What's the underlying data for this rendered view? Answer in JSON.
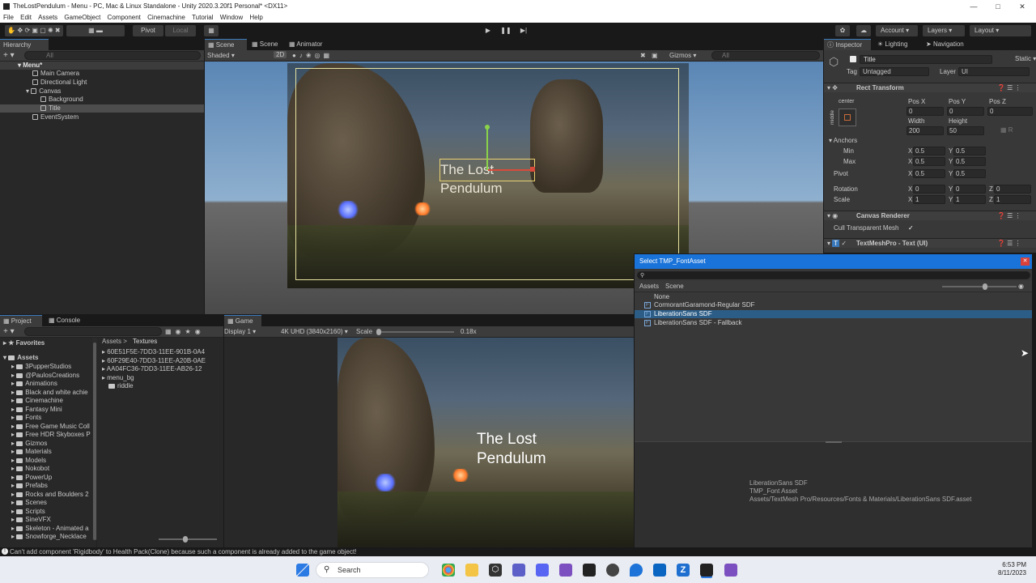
{
  "window": {
    "title": "TheLostPendulum - Menu - PC, Mac & Linux Standalone - Unity 2020.3.20f1 Personal* <DX11>"
  },
  "menubar": [
    "File",
    "Edit",
    "Assets",
    "GameObject",
    "Component",
    "Cinemachine",
    "Tutorial",
    "Window",
    "Help"
  ],
  "toolbar": {
    "pivot": "Pivot",
    "local": "Local",
    "account": "Account",
    "layers": "Layers",
    "layout": "Layout"
  },
  "hierarchy": {
    "tab": "Hierarchy",
    "search_placeholder": "All",
    "scene": "Menu*",
    "items": [
      "Main Camera",
      "Directional Light",
      "Canvas",
      "Background",
      "Title",
      "EventSystem"
    ]
  },
  "scene_view": {
    "tabs": [
      "Scene",
      "Scene",
      "Animator"
    ],
    "shading": "Shaded",
    "mode_2d": "2D",
    "gizmos": "Gizmos",
    "search_placeholder": "All",
    "overlay_title": "The Lost Pendulum"
  },
  "inspector": {
    "tabs": [
      "Inspector",
      "Lighting",
      "Navigation"
    ],
    "object_name": "Title",
    "static_label": "Static",
    "tag_label": "Tag",
    "tag_value": "Untagged",
    "layer_label": "Layer",
    "layer_value": "UI",
    "rect_transform": {
      "header": "Rect Transform",
      "anchor_preset": "center",
      "anchor_side": "middle",
      "pos_x_label": "Pos X",
      "pos_x": "0",
      "pos_y_label": "Pos Y",
      "pos_y": "0",
      "pos_z_label": "Pos Z",
      "pos_z": "0",
      "width_label": "Width",
      "width": "200",
      "height_label": "Height",
      "height": "50",
      "anchors_label": "Anchors",
      "min_label": "Min",
      "min_x": "0.5",
      "min_y": "0.5",
      "max_label": "Max",
      "max_x": "0.5",
      "max_y": "0.5",
      "pivot_label": "Pivot",
      "pivot_x": "0.5",
      "pivot_y": "0.5",
      "rotation_label": "Rotation",
      "rot_x": "0",
      "rot_y": "0",
      "rot_z": "0",
      "scale_label": "Scale",
      "scale_x": "1",
      "scale_y": "1",
      "scale_z": "1",
      "x": "X",
      "y": "Y",
      "z": "Z"
    },
    "canvas_renderer": {
      "header": "Canvas Renderer",
      "cull_label": "Cull Transparent Mesh"
    },
    "textmeshpro": {
      "header": "TextMeshPro - Text (UI)"
    }
  },
  "project": {
    "tabs": [
      "Project",
      "Console"
    ],
    "favorites": "Favorites",
    "assets_root": "Assets",
    "folders": [
      "3PupperStudios",
      "@PaulosCreations",
      "Animations",
      "Black and white achie",
      "Cinemachine",
      "Fantasy Mini",
      "Fonts",
      "Free Game Music Coll",
      "Free HDR Skyboxes P",
      "Gizmos",
      "Materials",
      "Models",
      "Nokobot",
      "PowerUp",
      "Prefabs",
      "Rocks and Boulders 2",
      "Scenes",
      "Scripts",
      "SineVFX",
      "Skeleton - Animated a",
      "Snowforge_Necklace"
    ],
    "breadcrumb": [
      "Assets",
      "Textures"
    ],
    "files": [
      "60E51F5E-7DD3-11EE-901B-0A4",
      "60F29E40-7DD3-11EE-A20B-0AE",
      "AA04FC36-7DD3-11EE-AB26-12",
      "menu_bg",
      "riddle"
    ]
  },
  "game_view": {
    "tab": "Game",
    "display": "Display 1",
    "resolution": "4K UHD (3840x2160)",
    "scale_label": "Scale",
    "scale_value": "0.18x",
    "overlay_line1": "The Lost",
    "overlay_line2": "Pendulum"
  },
  "picker": {
    "title": "Select TMP_FontAsset",
    "tabs": [
      "Assets",
      "Scene"
    ],
    "items": [
      "None",
      "CormorantGaramond-Regular SDF",
      "LiberationSans SDF",
      "LiberationSans SDF - Fallback"
    ],
    "selected_index": 2,
    "preview_name": "LiberationSans SDF",
    "preview_type": "TMP_Font Asset",
    "preview_path": "Assets/TextMesh Pro/Resources/Fonts & Materials/LiberationSans SDF.asset"
  },
  "status": {
    "message": "Can't add component 'Rigidbody' to Health Pack(Clone) because such a component is already added to the game object!"
  },
  "taskbar": {
    "search_label": "Search",
    "time": "6:53 PM",
    "date": "8/11/2023"
  },
  "colors": {
    "accent": "#3a79bb",
    "selection": "#2c5d87",
    "dialog_title": "#1a73d9"
  }
}
